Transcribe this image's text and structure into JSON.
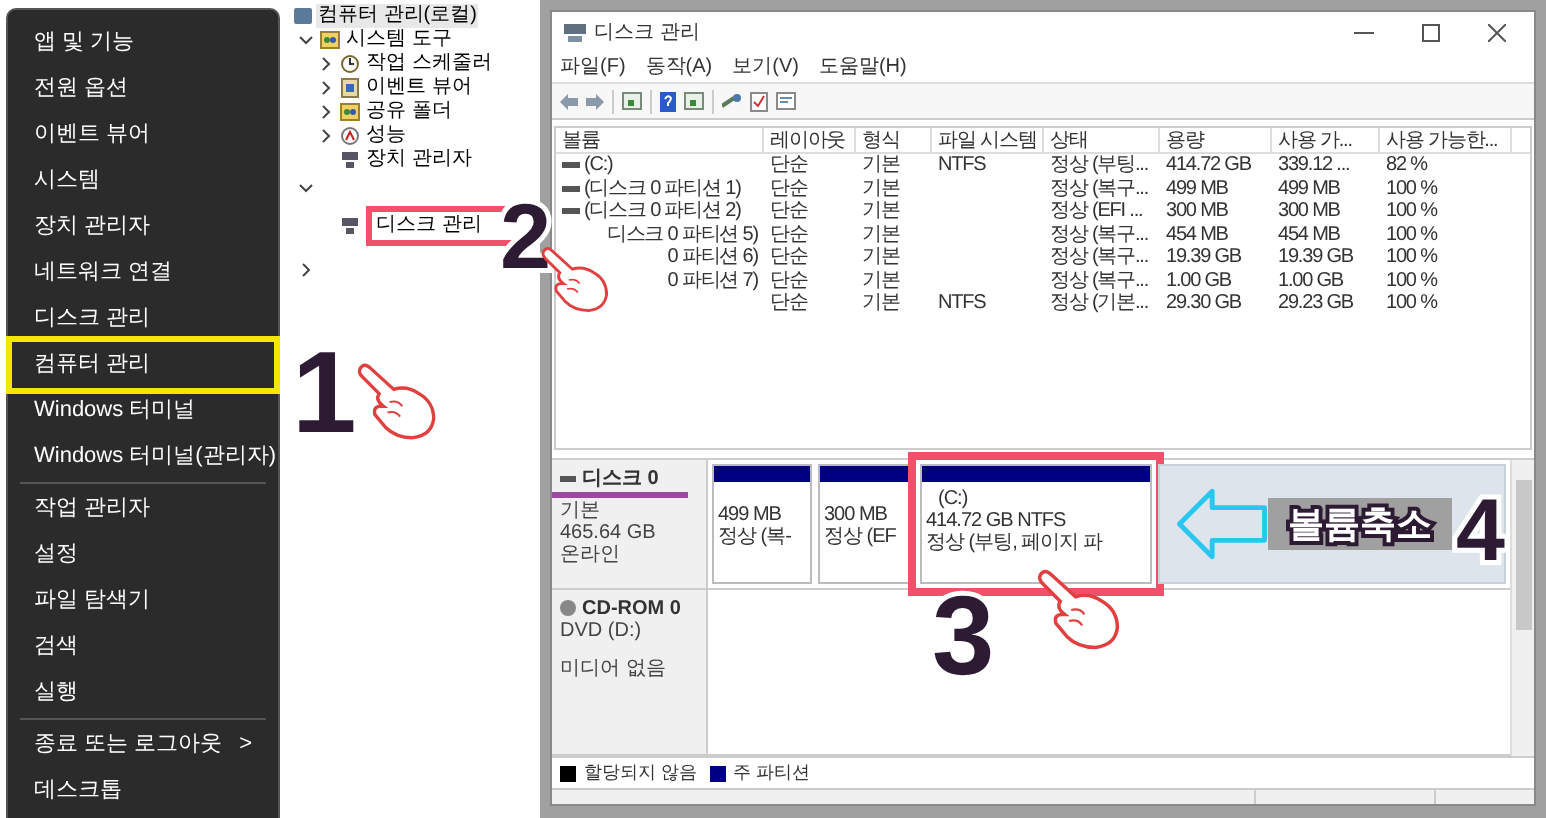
{
  "start_menu": {
    "items": [
      {
        "label": "앱 및 기능",
        "marked": false,
        "group_end": false
      },
      {
        "label": "전원 옵션",
        "marked": false,
        "group_end": false
      },
      {
        "label": "이벤트 뷰어",
        "marked": false,
        "group_end": false
      },
      {
        "label": "시스템",
        "marked": false,
        "group_end": false
      },
      {
        "label": "장치 관리자",
        "marked": false,
        "group_end": false
      },
      {
        "label": "네트워크 연결",
        "marked": false,
        "group_end": false
      },
      {
        "label": "디스크 관리",
        "marked": false,
        "group_end": false
      },
      {
        "label": "컴퓨터 관리",
        "marked": true,
        "group_end": false
      },
      {
        "label": "Windows 터미널",
        "marked": false,
        "group_end": false
      },
      {
        "label": "Windows 터미널(관리자)",
        "marked": false,
        "group_end": true
      },
      {
        "label": "작업 관리자",
        "marked": false,
        "group_end": false
      },
      {
        "label": "설정",
        "marked": false,
        "group_end": false
      },
      {
        "label": "파일 탐색기",
        "marked": false,
        "group_end": false
      },
      {
        "label": "검색",
        "marked": false,
        "group_end": false
      },
      {
        "label": "실행",
        "marked": false,
        "group_end": true
      },
      {
        "label": "종료 또는 로그아웃",
        "arrow": ">",
        "marked": false,
        "group_end": false
      },
      {
        "label": "데스크톱",
        "marked": false,
        "group_end": false
      }
    ]
  },
  "tree": {
    "root": "컴퓨터 관리(로컬)",
    "items": [
      {
        "label": "시스템 도구",
        "expanded": true,
        "children": [
          {
            "label": "작업 스케줄러",
            "expanded": false
          },
          {
            "label": "이벤트 뷰어",
            "expanded": false
          },
          {
            "label": "공유 폴더",
            "expanded": false
          },
          {
            "label": "성능",
            "expanded": false
          },
          {
            "label": "장치 관리자"
          }
        ]
      },
      {
        "expanded": true,
        "children": [
          {
            "label": "디스크 관리",
            "marked": true
          }
        ]
      },
      {
        "expanded": false
      }
    ]
  },
  "window": {
    "title": "디스크 관리",
    "menu": [
      "파일(F)",
      "동작(A)",
      "보기(V)",
      "도움말(H)"
    ]
  },
  "volumes": {
    "columns": [
      "볼륨",
      "레이아웃",
      "형식",
      "파일 시스템",
      "상태",
      "용량",
      "사용 가...",
      "사용 가능한..."
    ],
    "rows": [
      {
        "icon": true,
        "cells": [
          "(C:)",
          "단순",
          "기본",
          "NTFS",
          "정상 (부팅...",
          "414.72 GB",
          "339.12 ...",
          "82 %"
        ]
      },
      {
        "icon": true,
        "cells": [
          "(디스크 0 파티션 1)",
          "단순",
          "기본",
          null,
          "정상 (복구...",
          "499 MB",
          "499 MB",
          "100 %"
        ]
      },
      {
        "icon": true,
        "cells": [
          "(디스크 0 파티션 2)",
          "단순",
          "기본",
          null,
          "정상 (EFI ...",
          "300 MB",
          "300 MB",
          "100 %"
        ]
      },
      {
        "icon": false,
        "cells": [
          "디스크 0 파티션 5)",
          "단순",
          "기본",
          null,
          "정상 (복구...",
          "454 MB",
          "454 MB",
          "100 %"
        ]
      },
      {
        "icon": false,
        "cells": [
          "0 파티션 6)",
          "단순",
          "기본",
          null,
          "정상 (복구...",
          "19.39 GB",
          "19.39 GB",
          "100 %"
        ]
      },
      {
        "icon": false,
        "cells": [
          "0 파티션 7)",
          "단순",
          "기본",
          null,
          "정상 (복구...",
          "1.00 GB",
          "1.00 GB",
          "100 %"
        ]
      },
      {
        "icon": false,
        "cells": [
          null,
          "단순",
          "기본",
          "NTFS",
          "정상 (기본...",
          "29.30 GB",
          "29.23 GB",
          "100 %"
        ]
      }
    ]
  },
  "disks": [
    {
      "kind": "disk",
      "name": "디스크 0",
      "type": "기본",
      "size": "465.64 GB",
      "status": "온라인",
      "partitions": [
        {
          "size": "499 MB",
          "status": "정상 (복-",
          "marked": false
        },
        {
          "size": "300 MB",
          "status": "정상 (EF",
          "marked": false
        },
        {
          "label": "(C:)",
          "size": "414.72 GB NTFS",
          "status": "정상 (부팅, 페이지 파",
          "marked": true
        }
      ]
    },
    {
      "kind": "cdrom",
      "name": "CD-ROM 0",
      "type": "DVD (D:)",
      "status": "미디어 없음"
    }
  ],
  "legend": [
    {
      "label": "할당되지 않음",
      "color": "#000000"
    },
    {
      "label": "주 파티션",
      "color": "#000080"
    }
  ],
  "annotations": {
    "steps": [
      "1",
      "2",
      "3",
      "4"
    ],
    "callout": "볼륨축소"
  }
}
